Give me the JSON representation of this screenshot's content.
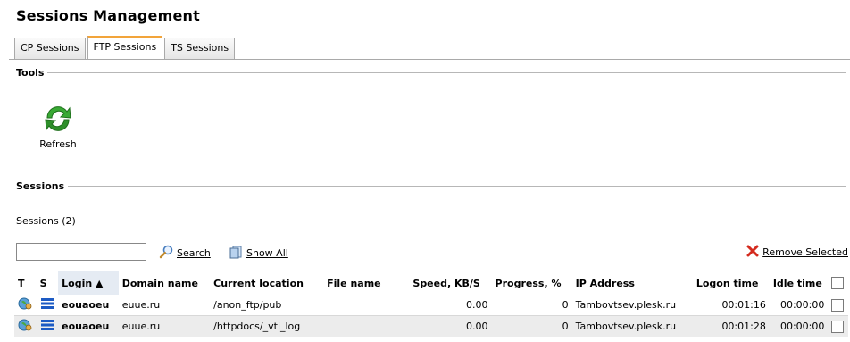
{
  "page": {
    "title": "Sessions Management"
  },
  "tabs": [
    {
      "label": "CP Sessions",
      "active": false
    },
    {
      "label": "FTP Sessions",
      "active": true
    },
    {
      "label": "TS Sessions",
      "active": false
    }
  ],
  "tools": {
    "heading": "Tools",
    "refresh_label": "Refresh",
    "refresh_icon": "refresh-icon",
    "refresh_color": "#2e9b2a"
  },
  "sessions": {
    "heading": "Sessions",
    "count_text": "Sessions (2)",
    "search_value": "",
    "search_label": "Search",
    "show_all_label": "Show All",
    "remove_selected_label": "Remove Selected",
    "remove_icon_color": "#d42b1e"
  },
  "table": {
    "columns": [
      "T",
      "S",
      "Login ▲",
      "Domain name",
      "Current location",
      "File name",
      "Speed, KB/S",
      "Progress, %",
      "IP Address",
      "Logon time",
      "Idle time"
    ],
    "sorted_column": "Login",
    "rows": [
      {
        "type_icon": "ftp-user-icon",
        "status_icon": "active-session-icon",
        "login": "eouaoeu",
        "domain": "euue.ru",
        "location": "/anon_ftp/pub",
        "file": "",
        "speed": "0.00",
        "progress": "0",
        "ip": "Tambovtsev.plesk.ru",
        "logon": "00:01:16",
        "idle": "00:00:00"
      },
      {
        "type_icon": "ftp-user-icon",
        "status_icon": "active-session-icon",
        "login": "eouaoeu",
        "domain": "euue.ru",
        "location": "/httpdocs/_vti_log",
        "file": "",
        "speed": "0.00",
        "progress": "0",
        "ip": "Tambovtsev.plesk.ru",
        "logon": "00:01:28",
        "idle": "00:00:00"
      }
    ]
  }
}
